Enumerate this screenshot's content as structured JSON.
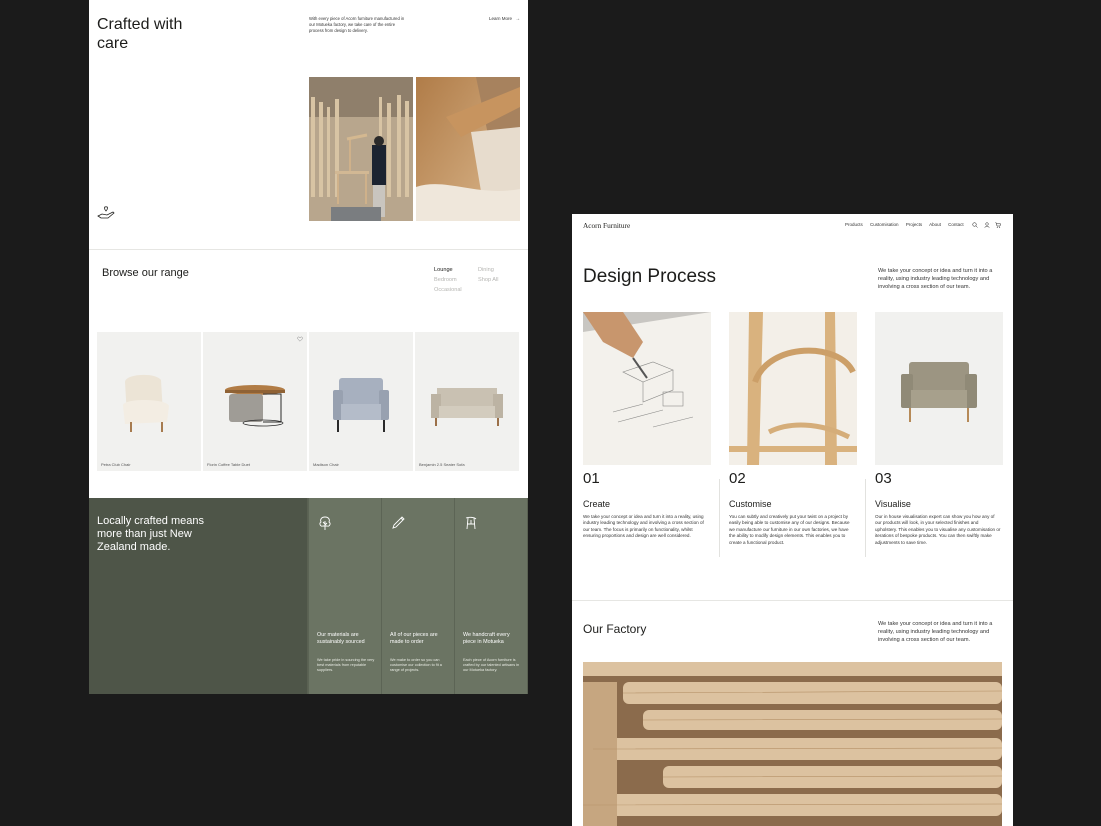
{
  "left_page": {
    "hero": {
      "title": "Crafted with care",
      "text": "With every piece of Acorn furniture manufactured in our Motueka factory, we take care of the entire process from design to delivery.",
      "learn_more": "Learn More",
      "arrow_icon": "arrow-right-icon",
      "hand_icon": "hand-heart-icon"
    },
    "browse": {
      "title": "Browse our range",
      "ranges": [
        "Lounge",
        "Bedroom",
        "Occasional",
        "Dining",
        "Shop All"
      ],
      "active_range": "Lounge"
    },
    "products": [
      {
        "name": "Petra Club Chair"
      },
      {
        "name": "Florin Coffee Table Duet",
        "icon": "heart-icon"
      },
      {
        "name": "Madison Chair"
      },
      {
        "name": "Benjamin 2.5 Seater Sofa"
      }
    ],
    "local": {
      "title": "Locally crafted means more than just New Zealand made.",
      "columns": [
        {
          "icon": "tree-icon",
          "title": "Our materials are sustainably sourced",
          "text": "We take pride in sourcing the very best materials from reputable suppliers."
        },
        {
          "icon": "pencil-icon",
          "title": "All of our pieces are made to order",
          "text": "We make to order so you can customise our collection to fit a range of projects."
        },
        {
          "icon": "chair-icon",
          "title": "We handcraft every piece in Motueka",
          "text": "Each piece of Acorn furniture is crafted by our talented artisans in our Motueka factory."
        }
      ]
    }
  },
  "right_page": {
    "nav": {
      "logo": "Acorn Furniture",
      "links": [
        "Products",
        "Customisation",
        "Projects",
        "About",
        "Contact"
      ],
      "icons": [
        "search-icon",
        "user-icon",
        "cart-icon"
      ]
    },
    "design_process": {
      "title": "Design Process",
      "text": "We take your concept or idea and turn it into a reality, using industry leading technology and involving a cross section of our team.",
      "steps": [
        {
          "num": "01",
          "title": "Create",
          "text": "We take your concept or idea and turn it into a reality, using industry leading technology and involving a cross section of our team. The focus is primarily on functionality, whilst ensuring proportions and design are well considered."
        },
        {
          "num": "02",
          "title": "Customise",
          "text": "You can subtly and creatively put your twist on a project by easily being able to customise any of our designs. Because we manufacture our furniture in our own factories, we have the ability to modify design elements. This enables you to create a functional product."
        },
        {
          "num": "03",
          "title": "Visualise",
          "text": "Our in house visualisation expert can show you how any of our products will look, in your selected finishes and upholstery. This enables you to visualise any customisation or iterations of bespoke products. You can then swiftly make adjustments to save time."
        }
      ]
    },
    "factory": {
      "title": "Our Factory",
      "text": "We take your concept or idea and turn it into a reality, using industry leading technology and involving a cross section of our team."
    }
  },
  "colors": {
    "page_bg": "#1b1b1b",
    "green_dark": "#4e5548",
    "green_mid": "#6b7463",
    "wood": "#c9a57a"
  }
}
